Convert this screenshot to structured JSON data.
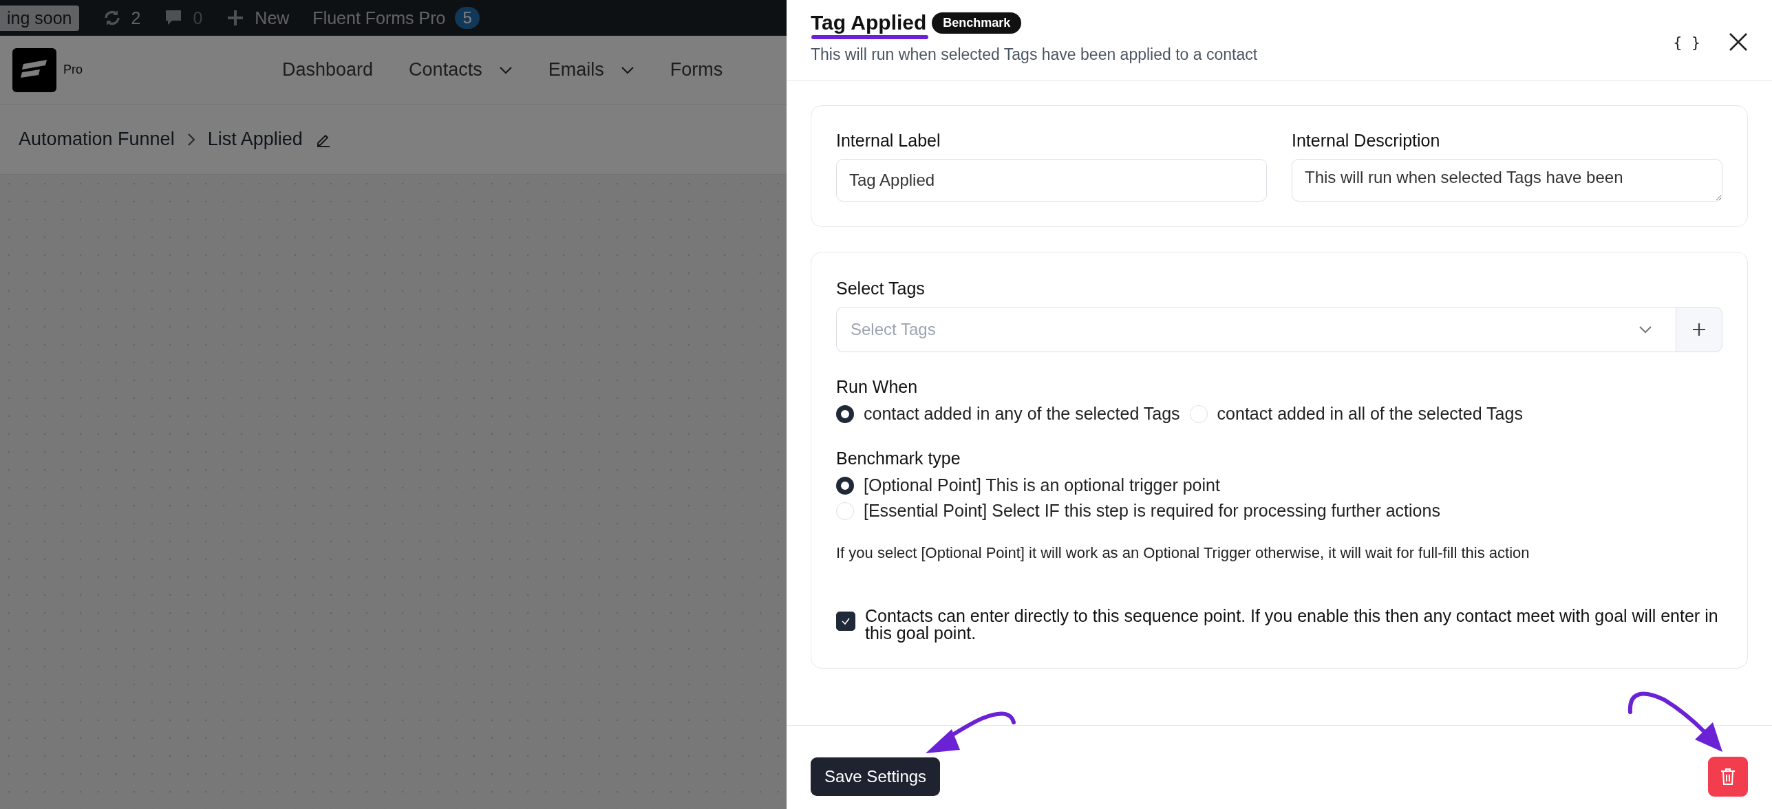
{
  "admin_bar": {
    "items": [
      {
        "kind": "badge",
        "label": "ing soon"
      },
      {
        "kind": "updates",
        "label": "2"
      },
      {
        "kind": "comments",
        "label": "0"
      },
      {
        "kind": "new",
        "label": "New"
      },
      {
        "kind": "plugin",
        "label": "Fluent Forms Pro",
        "count": "5"
      }
    ]
  },
  "nav": {
    "logo_label": "Pro",
    "items": [
      {
        "label": "Dashboard",
        "dropdown": false
      },
      {
        "label": "Contacts",
        "dropdown": true
      },
      {
        "label": "Emails",
        "dropdown": true
      },
      {
        "label": "Forms",
        "dropdown": false
      }
    ]
  },
  "breadcrumb": {
    "items": [
      "Automation Funnel",
      "List Applied"
    ]
  },
  "drawer": {
    "title": "Tag Applied",
    "badge": "Benchmark",
    "subtitle": "This will run when selected Tags have been applied to a contact",
    "code_button": "{ }",
    "internal_label": {
      "label": "Internal Label",
      "value": "Tag Applied"
    },
    "internal_description": {
      "label": "Internal Description",
      "value": "This will run when selected Tags have been"
    },
    "select_tags": {
      "label": "Select Tags",
      "placeholder": "Select Tags"
    },
    "run_when": {
      "label": "Run When",
      "options": [
        {
          "label": "contact added in any of the selected Tags",
          "selected": true
        },
        {
          "label": "contact added in all of the selected Tags",
          "selected": false
        }
      ]
    },
    "benchmark_type": {
      "label": "Benchmark type",
      "options": [
        {
          "label": "[Optional Point] This is an optional trigger point",
          "selected": true
        },
        {
          "label": "[Essential Point] Select IF this step is required for processing further actions",
          "selected": false
        }
      ]
    },
    "help_text": "If you select [Optional Point] it will work as an Optional Trigger otherwise, it will wait for full-fill this action",
    "direct_entry": {
      "label": "Contacts can enter directly to this sequence point. If you enable this then any contact meet with goal will enter in this goal point.",
      "checked": true
    },
    "save_button": "Save Settings"
  }
}
